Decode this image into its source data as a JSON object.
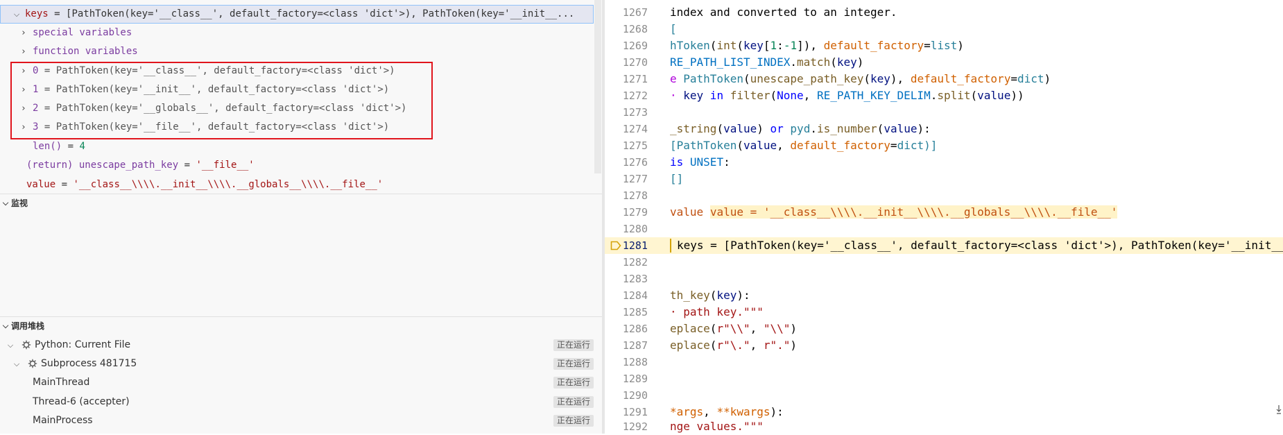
{
  "variables": {
    "keys_row": {
      "name": "keys",
      "eq": " = ",
      "value": "[PathToken(key='__class__', default_factory=<class 'dict'>), PathToken(key='__init__..."
    },
    "special": "special variables",
    "function": "function variables",
    "items": [
      {
        "idx": "0",
        "eq": " = ",
        "value": "PathToken(key='__class__', default_factory=<class 'dict'>)"
      },
      {
        "idx": "1",
        "eq": " = ",
        "value": "PathToken(key='__init__', default_factory=<class 'dict'>)"
      },
      {
        "idx": "2",
        "eq": " = ",
        "value": "PathToken(key='__globals__', default_factory=<class 'dict'>)"
      },
      {
        "idx": "3",
        "eq": " = ",
        "value": "PathToken(key='__file__', default_factory=<class 'dict'>)"
      }
    ],
    "len": {
      "label": "len()",
      "eq": " = ",
      "value": "4"
    },
    "return_row": {
      "name": "(return) unescape_path_key",
      "eq": " = ",
      "value": "'__file__'"
    },
    "value_row": {
      "name": "value",
      "eq": " = ",
      "value": "'__class__\\\\\\\\.__init__\\\\\\\\.__globals__\\\\\\\\.__file__'"
    }
  },
  "watch": {
    "title": "监视"
  },
  "callstack": {
    "title": "调用堆栈",
    "rows": [
      {
        "label": "Python: Current File",
        "status": "正在运行"
      },
      {
        "label": "Subprocess 481715",
        "status": "正在运行"
      },
      {
        "label": "MainThread",
        "status": "正在运行"
      },
      {
        "label": "Thread-6 (accepter)",
        "status": "正在运行"
      },
      {
        "label": "MainProcess",
        "status": "正在运行"
      }
    ]
  },
  "editor": {
    "line_numbers": [
      "1267",
      "1268",
      "1269",
      "1270",
      "1271",
      "1272",
      "1273",
      "1274",
      "1275",
      "1276",
      "1277",
      "1278",
      "1279",
      "1280",
      "1281",
      "1282",
      "1283",
      "1284",
      "1285",
      "1286",
      "1287",
      "1288",
      "1289",
      "1290",
      "1291",
      "1292"
    ],
    "code": {
      "l1267": "index and converted to an integer.",
      "l1268": "[",
      "l1269": [
        "hToken",
        "(",
        "int",
        "(",
        "key",
        "[",
        "1",
        ":",
        "-1",
        "]), ",
        "default_factory",
        "=",
        "list",
        ")"
      ],
      "l1270": [
        "RE_PATH_LIST_INDEX",
        ".",
        "match",
        "(",
        "key",
        ")"
      ],
      "l1271": [
        "e ",
        "PathToken",
        "(",
        "unescape_path_key",
        "(",
        "key",
        "), ",
        "default_factory",
        "=",
        "dict",
        ")"
      ],
      "l1272": [
        "· ",
        "key",
        " in ",
        "filter",
        "(",
        "None",
        ", ",
        "RE_PATH_KEY_DELIM",
        ".",
        "split",
        "(",
        "value",
        "))"
      ],
      "l1274": [
        "_string",
        "(",
        "value",
        ") ",
        "or",
        " ",
        "pyd",
        ".",
        "is_number",
        "(",
        "value",
        "):"
      ],
      "l1275": [
        "[",
        "PathToken",
        "(",
        "value",
        ", ",
        "default_factory",
        "=",
        "dict",
        ")]"
      ],
      "l1276": [
        "is ",
        "UNSET",
        ":"
      ],
      "l1277": "[]",
      "l1279": [
        "value",
        " ",
        "value = '__class__\\\\\\\\.__init__\\\\\\\\.__globals__\\\\\\\\.__file__'"
      ],
      "l1281": "keys = [PathToken(key='__class__', default_factory=<class 'dict'>), PathToken(key='__init__",
      "l1284": [
        "th_key",
        "(",
        "key",
        "):"
      ],
      "l1285": [
        "· path key.\"\"\""
      ],
      "l1286": [
        "eplace",
        "(",
        "r\"\\\\\"",
        ", ",
        "\"\\\\\"",
        ")"
      ],
      "l1287": [
        "eplace",
        "(",
        "r\"\\.\"",
        ", ",
        "r\".\"",
        ")"
      ],
      "l1291": [
        "*args",
        ", ",
        "**kwargs",
        "):"
      ],
      "l1292": [
        "nge values.\"\"\""
      ]
    }
  }
}
